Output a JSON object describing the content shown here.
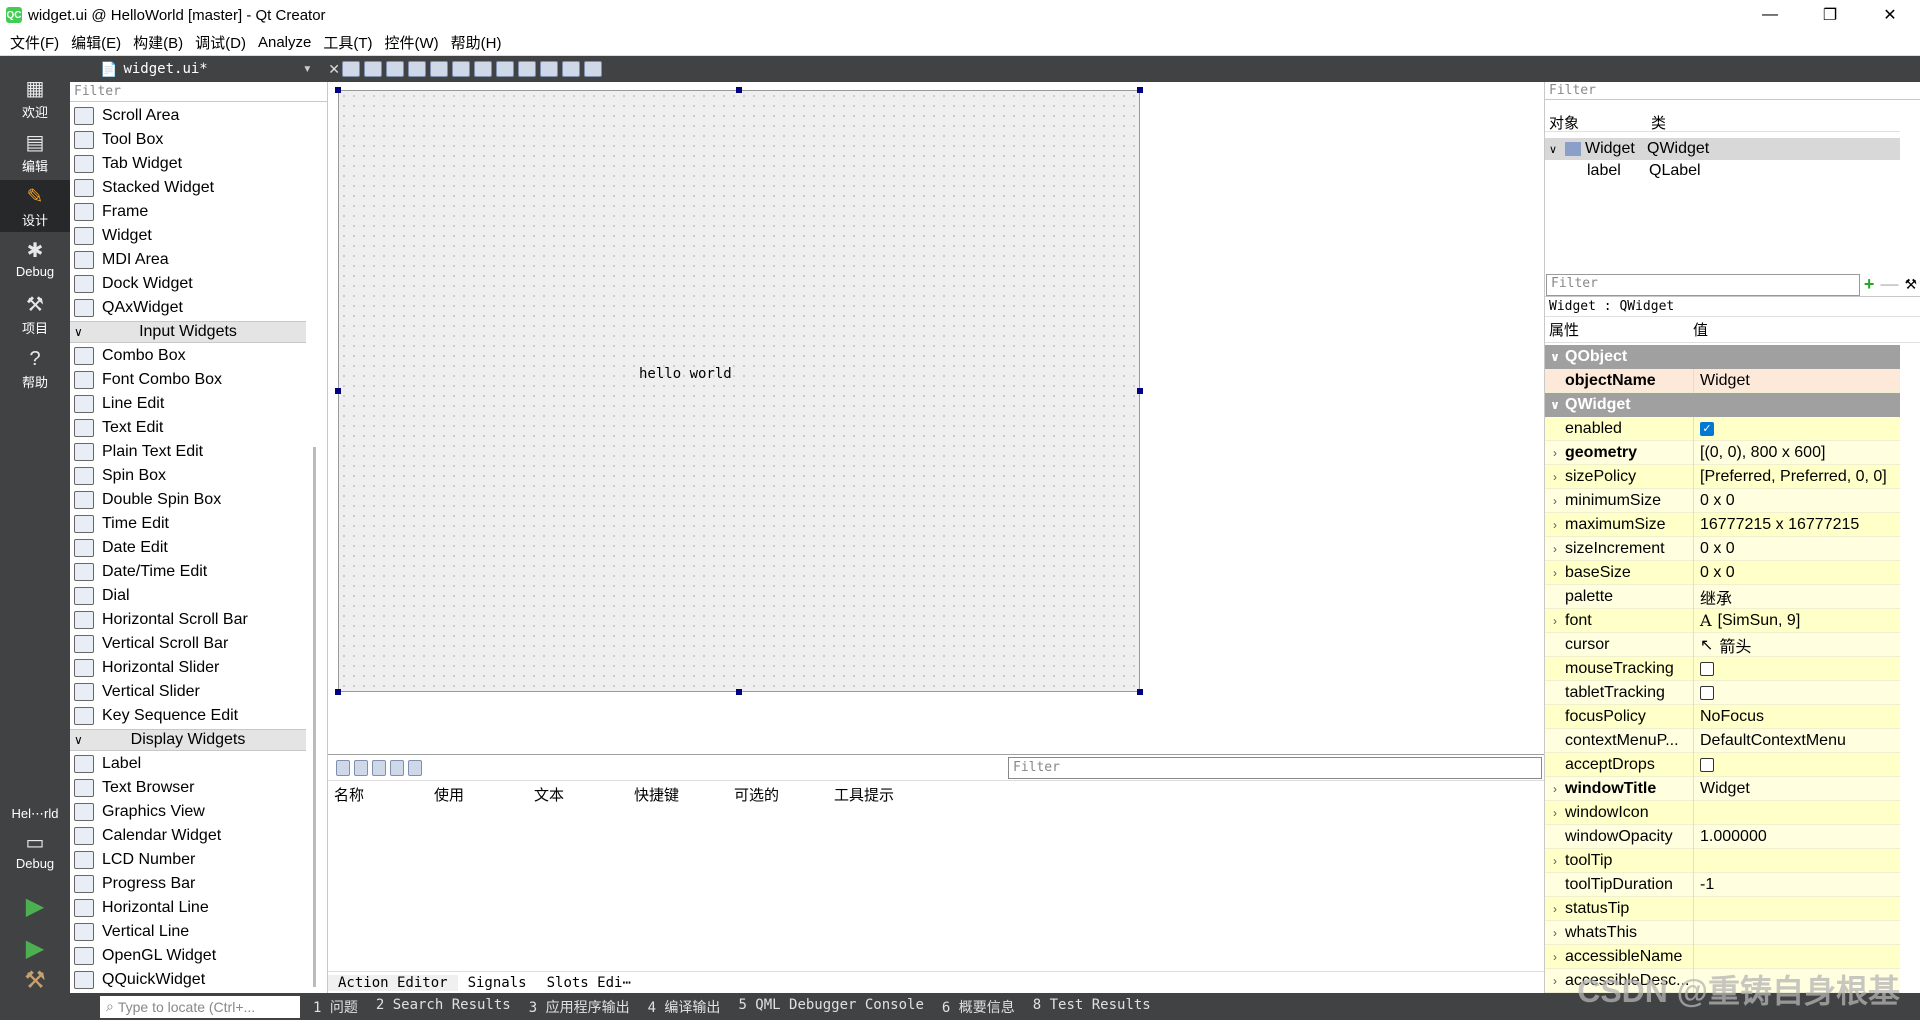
{
  "window": {
    "title": "widget.ui @ HelloWorld [master] - Qt Creator",
    "minimize": "—",
    "maximize": "❐",
    "close": "✕"
  },
  "menus": [
    "文件(F)",
    "编辑(E)",
    "构建(B)",
    "调试(D)",
    "Analyze",
    "工具(T)",
    "控件(W)",
    "帮助(H)"
  ],
  "modes": [
    {
      "label": "欢迎",
      "icon": "grid-icon"
    },
    {
      "label": "编辑",
      "icon": "edit-doc-icon"
    },
    {
      "label": "设计",
      "icon": "pencil-icon"
    },
    {
      "label": "Debug",
      "icon": "bug-icon"
    },
    {
      "label": "项目",
      "icon": "wrench-icon"
    },
    {
      "label": "帮助",
      "icon": "help-icon"
    }
  ],
  "kit": {
    "project": "Hel⋯rld",
    "config": "Debug"
  },
  "editor": {
    "open_file": "widget.ui*"
  },
  "widgetbox": {
    "filter_placeholder": "Filter",
    "containers": [
      "Scroll Area",
      "Tool Box",
      "Tab Widget",
      "Stacked Widget",
      "Frame",
      "Widget",
      "MDI Area",
      "Dock Widget",
      "QAxWidget"
    ],
    "input_title": "Input Widgets",
    "input": [
      "Combo Box",
      "Font Combo Box",
      "Line Edit",
      "Text Edit",
      "Plain Text Edit",
      "Spin Box",
      "Double Spin Box",
      "Time Edit",
      "Date Edit",
      "Date/Time Edit",
      "Dial",
      "Horizontal Scroll Bar",
      "Vertical Scroll Bar",
      "Horizontal Slider",
      "Vertical Slider",
      "Key Sequence Edit"
    ],
    "display_title": "Display Widgets",
    "display": [
      "Label",
      "Text Browser",
      "Graphics View",
      "Calendar Widget",
      "LCD Number",
      "Progress Bar",
      "Horizontal Line",
      "Vertical Line",
      "OpenGL Widget",
      "QQuickWidget"
    ]
  },
  "form": {
    "label_text": "hello world"
  },
  "action_editor": {
    "filter_placeholder": "Filter",
    "columns": [
      "名称",
      "使用",
      "文本",
      "快捷键",
      "可选的",
      "工具提示"
    ],
    "tabs": [
      "Action Editor",
      "Signals",
      "Slots Edi⋯"
    ]
  },
  "object_inspector": {
    "filter_placeholder": "Filter",
    "col_object": "对象",
    "col_class": "类",
    "rows": [
      {
        "name": "Widget",
        "cls": "QWidget"
      },
      {
        "name": "label",
        "cls": "QLabel"
      }
    ]
  },
  "property_editor": {
    "filter_placeholder": "Filter",
    "class_line": "Widget : QWidget",
    "col_prop": "属性",
    "col_value": "值",
    "groups": [
      "QObject",
      "QWidget"
    ],
    "props": [
      {
        "name": "objectName",
        "value": "Widget"
      },
      {
        "name": "enabled",
        "value": ""
      },
      {
        "name": "geometry",
        "value": "[(0, 0), 800 x 600]"
      },
      {
        "name": "sizePolicy",
        "value": "[Preferred, Preferred, 0, 0]"
      },
      {
        "name": "minimumSize",
        "value": "0 x 0"
      },
      {
        "name": "maximumSize",
        "value": "16777215 x 16777215"
      },
      {
        "name": "sizeIncrement",
        "value": "0 x 0"
      },
      {
        "name": "baseSize",
        "value": "0 x 0"
      },
      {
        "name": "palette",
        "value": "继承"
      },
      {
        "name": "font",
        "value": "[SimSun, 9]"
      },
      {
        "name": "cursor",
        "value": "箭头"
      },
      {
        "name": "mouseTracking",
        "value": ""
      },
      {
        "name": "tabletTracking",
        "value": ""
      },
      {
        "name": "focusPolicy",
        "value": "NoFocus"
      },
      {
        "name": "contextMenuP...",
        "value": "DefaultContextMenu"
      },
      {
        "name": "acceptDrops",
        "value": ""
      },
      {
        "name": "windowTitle",
        "value": "Widget"
      },
      {
        "name": "windowIcon",
        "value": ""
      },
      {
        "name": "windowOpacity",
        "value": "1.000000"
      },
      {
        "name": "toolTip",
        "value": ""
      },
      {
        "name": "toolTipDuration",
        "value": "-1"
      },
      {
        "name": "statusTip",
        "value": ""
      },
      {
        "name": "whatsThis",
        "value": ""
      },
      {
        "name": "accessibleName",
        "value": ""
      },
      {
        "name": "accessibleDesc...",
        "value": ""
      }
    ]
  },
  "statusbar": {
    "locator_placeholder": "Type to locate (Ctrl+...",
    "tabs": [
      "1 问题",
      "2 Search Results",
      "3 应用程序输出",
      "4 编译输出",
      "5 QML Debugger Console",
      "6 概要信息",
      "8 Test Results"
    ]
  },
  "watermark": "CSDN @重铸自身根基"
}
